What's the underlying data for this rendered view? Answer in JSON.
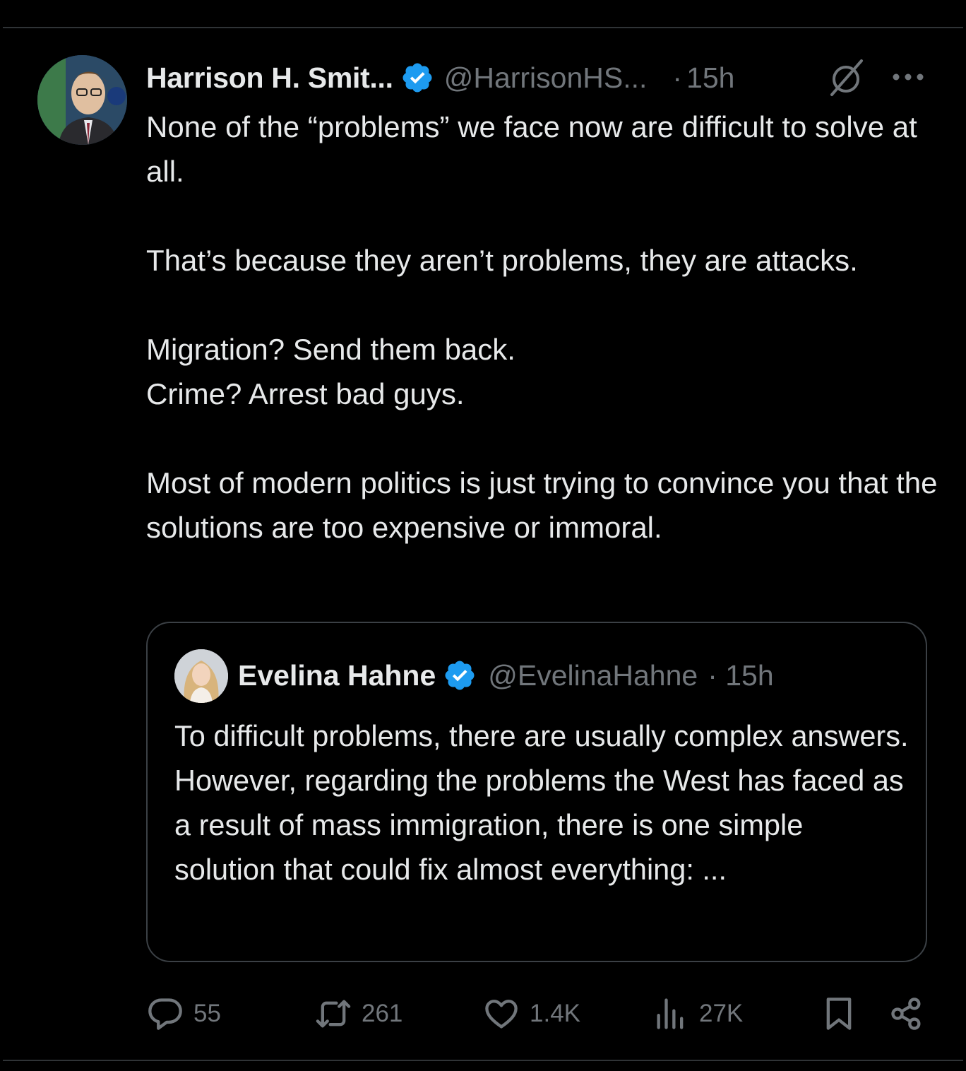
{
  "tweet": {
    "author_name": "Harrison H. Smit...",
    "handle": "@HarrisonHS...",
    "separator": "·",
    "time": "15h",
    "text": "None of the “problems” we face now are difficult to solve at all.\n\nThat’s because they aren’t problems, they are attacks.\n\nMigration? Send them back.\nCrime? Arrest bad guys.\n\nMost of modern politics is just trying to convince you that the solutions are too expensive or immoral."
  },
  "quote": {
    "author_name": "Evelina Hahne",
    "handle": "@EvelinaHahne",
    "time": "· 15h",
    "text": "To difficult problems, there are usually complex answers. However, regarding the problems the West has faced as a result of mass immigration, there is one simple solution that could fix almost everything: ..."
  },
  "actions": {
    "replies": "55",
    "reposts": "261",
    "likes": "1.4K",
    "views": "27K"
  },
  "icons": {
    "verified": "verified-badge-icon",
    "grok": "grok-icon",
    "more": "more-icon",
    "reply": "reply-icon",
    "repost": "repost-icon",
    "like": "heart-icon",
    "views": "views-icon",
    "bookmark": "bookmark-icon",
    "share": "share-icon"
  },
  "colors": {
    "background": "#000000",
    "text": "#e7e9ea",
    "muted": "#71767b",
    "verified": "#1d9bf0",
    "border": "#2f3336"
  }
}
